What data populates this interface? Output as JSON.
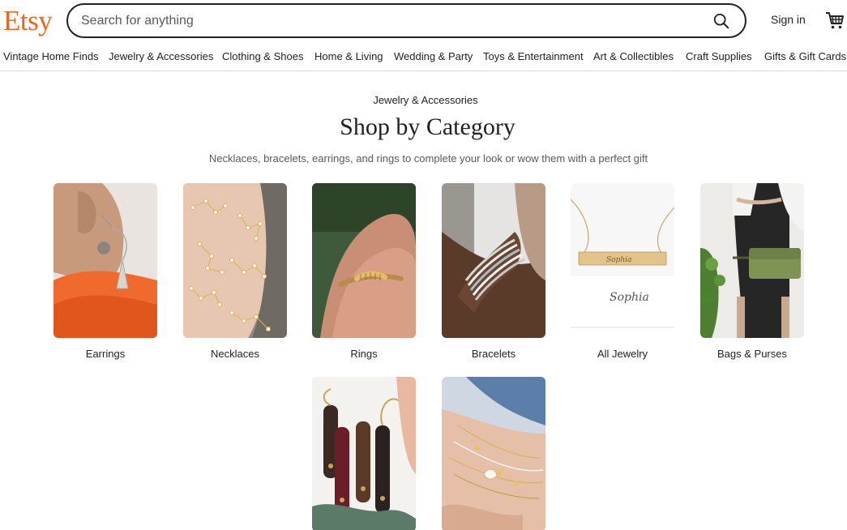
{
  "header": {
    "logo": "Etsy",
    "search_placeholder": "Search for anything",
    "signin_label": "Sign in"
  },
  "nav": {
    "items": [
      "Vintage Home Finds",
      "Jewelry & Accessories",
      "Clothing & Shoes",
      "Home & Living",
      "Wedding & Party",
      "Toys & Entertainment",
      "Art & Collectibles",
      "Craft Supplies",
      "Gifts & Gift Cards"
    ]
  },
  "main": {
    "breadcrumb": "Jewelry & Accessories",
    "title": "Shop by Category",
    "subtitle": "Necklaces, bracelets, earrings, and rings to complete your look or wow them with a perfect gift",
    "categories": [
      {
        "label": "Earrings"
      },
      {
        "label": "Necklaces"
      },
      {
        "label": "Rings"
      },
      {
        "label": "Bracelets"
      },
      {
        "label": "All Jewelry"
      },
      {
        "label": "Bags & Purses"
      },
      {
        "label": ""
      },
      {
        "label": ""
      }
    ]
  },
  "colors": {
    "brand": "#F1641E",
    "text": "#222222",
    "muted": "#595959"
  }
}
